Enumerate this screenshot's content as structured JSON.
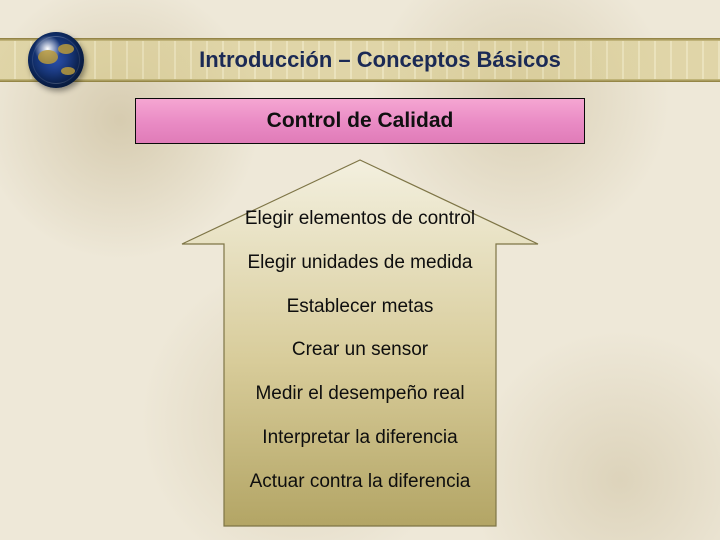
{
  "title": "Introducción – Conceptos Básicos",
  "banner": "Control de Calidad",
  "steps": [
    "Elegir elementos de control",
    "Elegir unidades de medida",
    "Establecer metas",
    "Crear un sensor",
    "Medir el desempeño real",
    "Interpretar la diferencia",
    "Actuar contra la diferencia"
  ],
  "colors": {
    "banner_fill": "#ec92c8",
    "banner_border": "#000000",
    "title_color": "#1b2a55",
    "arrow_fill_top": "#f3f0df",
    "arrow_fill_bot": "#b9ac6d",
    "arrow_stroke": "#7e7546"
  }
}
